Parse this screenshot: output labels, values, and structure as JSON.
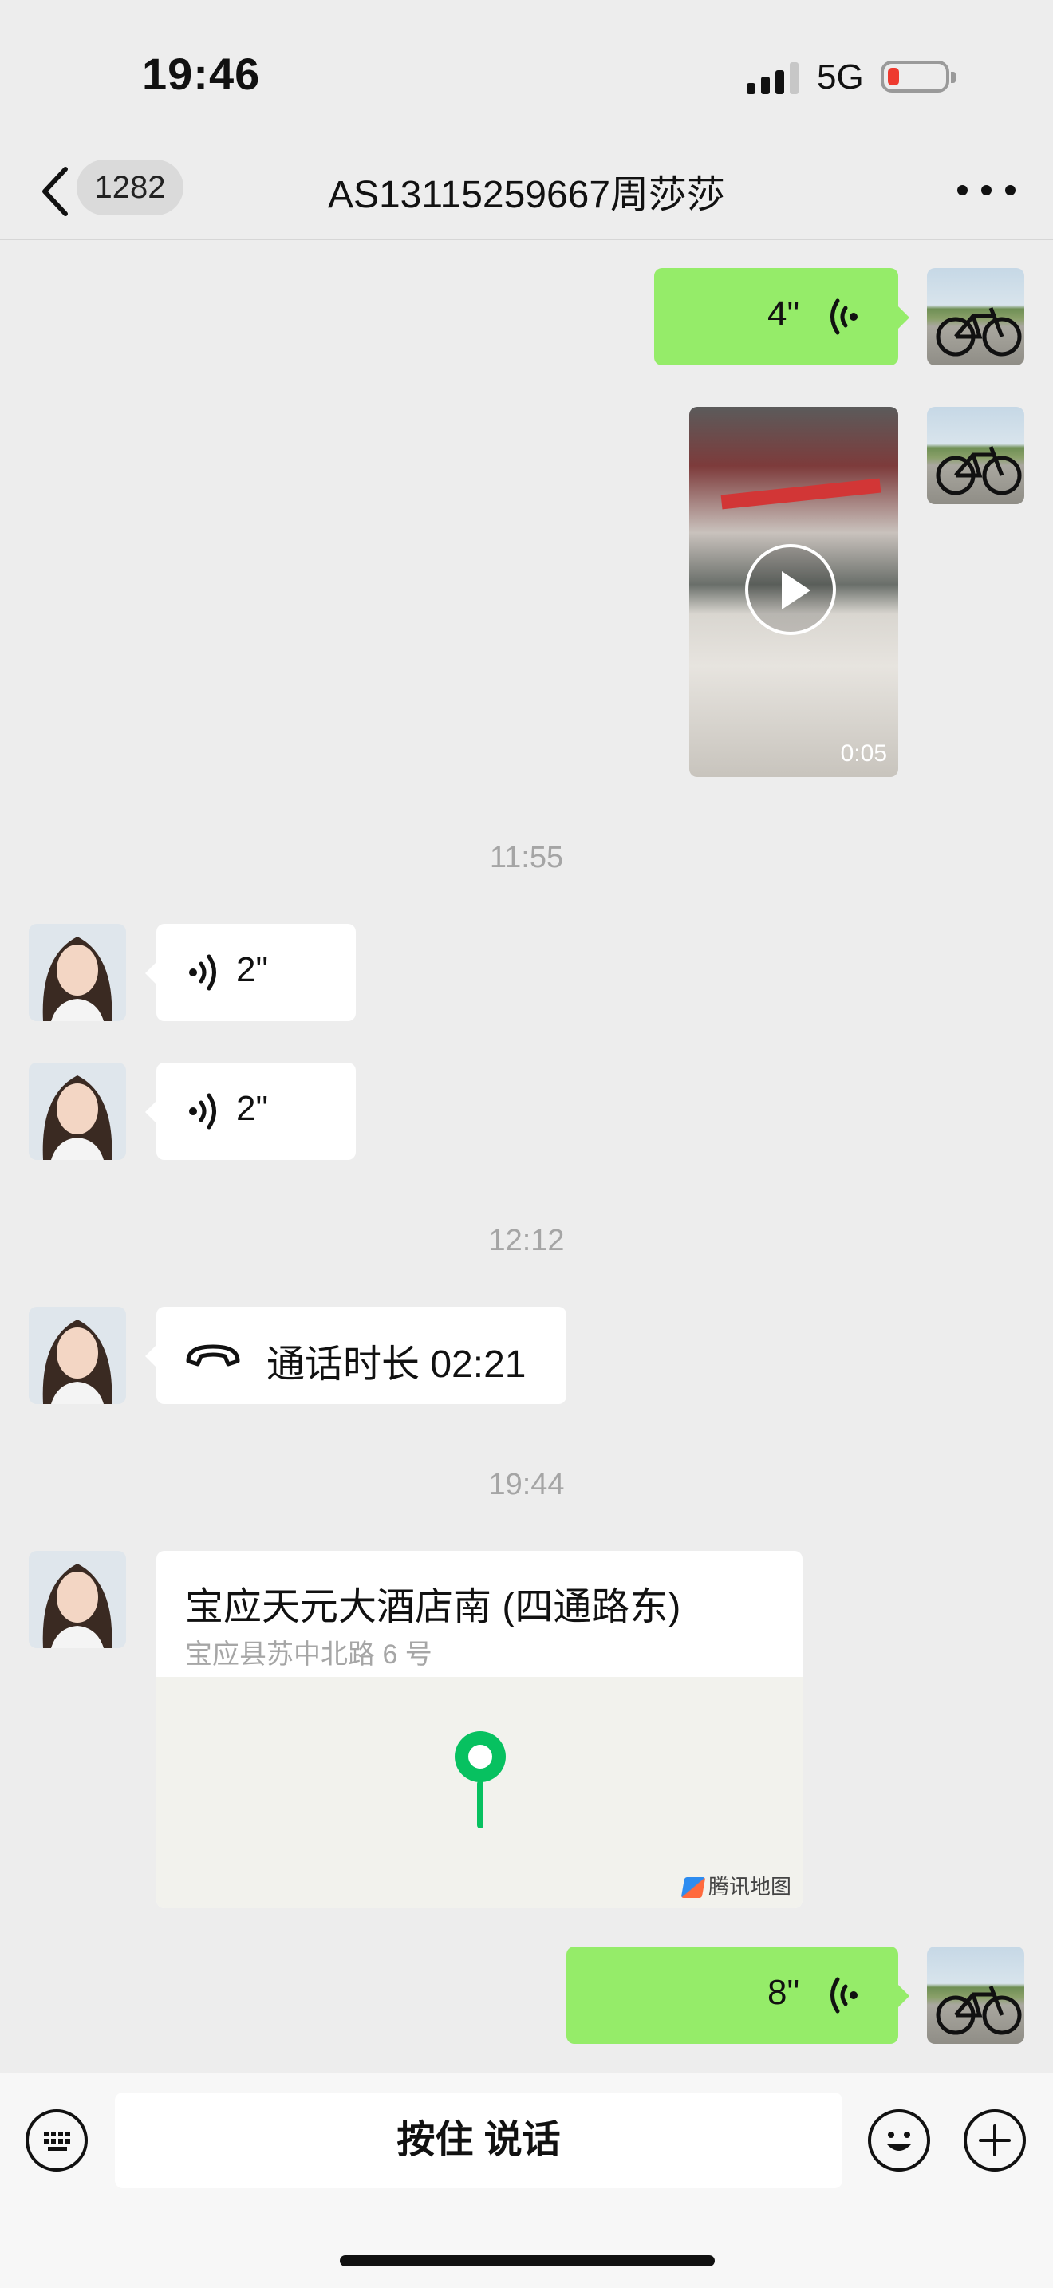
{
  "status_bar": {
    "time": "19:46",
    "network": "5G",
    "battery_level": 0.1,
    "battery_color": "#ee3a2f"
  },
  "nav": {
    "back_icon": "chevron-left-icon",
    "unread_count": "1282",
    "title": "AS13115259667周莎莎",
    "more_icon": "more-icon"
  },
  "messages": {
    "voice_out_1": {
      "duration": "4\""
    },
    "video_out": {
      "duration": "0:05"
    },
    "time_1": "11:55",
    "voice_in_1": {
      "duration": "2\""
    },
    "voice_in_2": {
      "duration": "2\""
    },
    "time_2": "12:12",
    "call_in": {
      "label": "通话时长 02:21"
    },
    "time_3": "19:44",
    "location_in": {
      "name": "宝应天元大酒店南 (四通路东)",
      "address": "宝应县苏中北路 6 号",
      "map_provider": "腾讯地图"
    },
    "voice_out_2": {
      "duration": "8\""
    }
  },
  "input_bar": {
    "hold_to_talk": "按住 说话",
    "keyboard_icon": "keyboard-icon",
    "emoji_icon": "emoji-icon",
    "plus_icon": "plus-icon"
  },
  "colors": {
    "outgoing_bubble": "#95ec69",
    "incoming_bubble": "#ffffff",
    "background": "#ededed",
    "map_pin": "#07c160"
  }
}
